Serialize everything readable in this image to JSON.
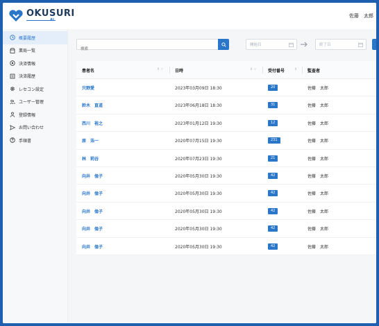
{
  "header": {
    "logo_text": "OKUSURI",
    "logo_sub": "AI",
    "user_name": "佐藤　太郎"
  },
  "sidebar": {
    "items": [
      {
        "label": "概要履歴",
        "icon": "clock-icon",
        "active": true
      },
      {
        "label": "業局一覧",
        "icon": "store-icon",
        "active": false
      },
      {
        "label": "決済情報",
        "icon": "circle-dollar-icon",
        "active": false
      },
      {
        "label": "決済履歴",
        "icon": "receipt-icon",
        "active": false
      },
      {
        "label": "レセコン設定",
        "icon": "gear-icon",
        "active": false
      },
      {
        "label": "ユーザー管理",
        "icon": "users-icon",
        "active": false
      },
      {
        "label": "登録情報",
        "icon": "person-icon",
        "active": false
      },
      {
        "label": "お問い合わせ",
        "icon": "send-icon",
        "active": false
      },
      {
        "label": "手順書",
        "icon": "question-icon",
        "active": false
      }
    ]
  },
  "filters": {
    "search_placeholder": "検索",
    "start_placeholder": "開始日",
    "end_placeholder": "終了日"
  },
  "table": {
    "headers": {
      "patient": "患者名",
      "datetime": "日時",
      "reception_no": "受付番号",
      "auditor": "監査者"
    },
    "rows": [
      {
        "patient": "只野愛",
        "datetime": "2023年03月09日 18:30",
        "reception_no": "20",
        "auditor": "佐藤　太郎"
      },
      {
        "patient": "鈴木　直道",
        "datetime": "2023年06月18日 18:30",
        "reception_no": "31",
        "auditor": "佐藤　太郎"
      },
      {
        "patient": "西川　裕之",
        "datetime": "2023年01月12日 19:30",
        "reception_no": "12",
        "auditor": "佐藤　太郎"
      },
      {
        "patient": "原　浩一",
        "datetime": "2020年07月15日 19:30",
        "reception_no": "231",
        "auditor": "佐藤　太郎"
      },
      {
        "patient": "林　莉谷",
        "datetime": "2020年07月23日 19:30",
        "reception_no": "21",
        "auditor": "佐藤　太郎"
      },
      {
        "patient": "向井　倫子",
        "datetime": "2020年05月30日 19:30",
        "reception_no": "42",
        "auditor": "佐藤　太郎"
      },
      {
        "patient": "向井　倫子",
        "datetime": "2020年05月30日 19:30",
        "reception_no": "42",
        "auditor": "佐藤　太郎"
      },
      {
        "patient": "向井　倫子",
        "datetime": "2020年05月30日 19:30",
        "reception_no": "42",
        "auditor": "佐藤　太郎"
      },
      {
        "patient": "向井　倫子",
        "datetime": "2020年05月30日 19:30",
        "reception_no": "42",
        "auditor": "佐藤　太郎"
      },
      {
        "patient": "向井　倫子",
        "datetime": "2020年05月30日 19:30",
        "reception_no": "42",
        "auditor": "佐藤　太郎"
      }
    ]
  },
  "colors": {
    "accent": "#2a77c9",
    "frame": "#1e5fb0",
    "sidebar_active_bg": "#e4eefb"
  }
}
